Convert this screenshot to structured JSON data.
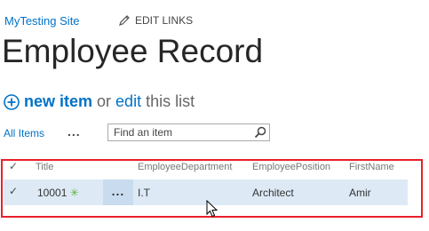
{
  "header": {
    "site_name": "MyTesting Site",
    "edit_links_label": "EDIT LINKS"
  },
  "page": {
    "title": "Employee Record"
  },
  "actions": {
    "new_item_label": "new item",
    "or_text": "or",
    "edit_label": "edit",
    "this_list_text": "this list"
  },
  "views": {
    "current_view": "All Items",
    "more_label": "..."
  },
  "search": {
    "placeholder": "Find an item",
    "value": ""
  },
  "list": {
    "columns": [
      "Title",
      "EmployeeDepartment",
      "EmployeePosition",
      "FirstName"
    ],
    "rows": [
      {
        "title": "10001",
        "new_badge": "✳",
        "menu_label": "...",
        "department": "I.T",
        "position": "Architect",
        "first_name": "Amir"
      }
    ]
  },
  "icons": {
    "checkmark": "✓"
  },
  "colors": {
    "accent": "#0072c6",
    "highlight_border": "#e8202a",
    "selected_row": "#ddeaf6",
    "new_badge": "#5bb53f"
  }
}
